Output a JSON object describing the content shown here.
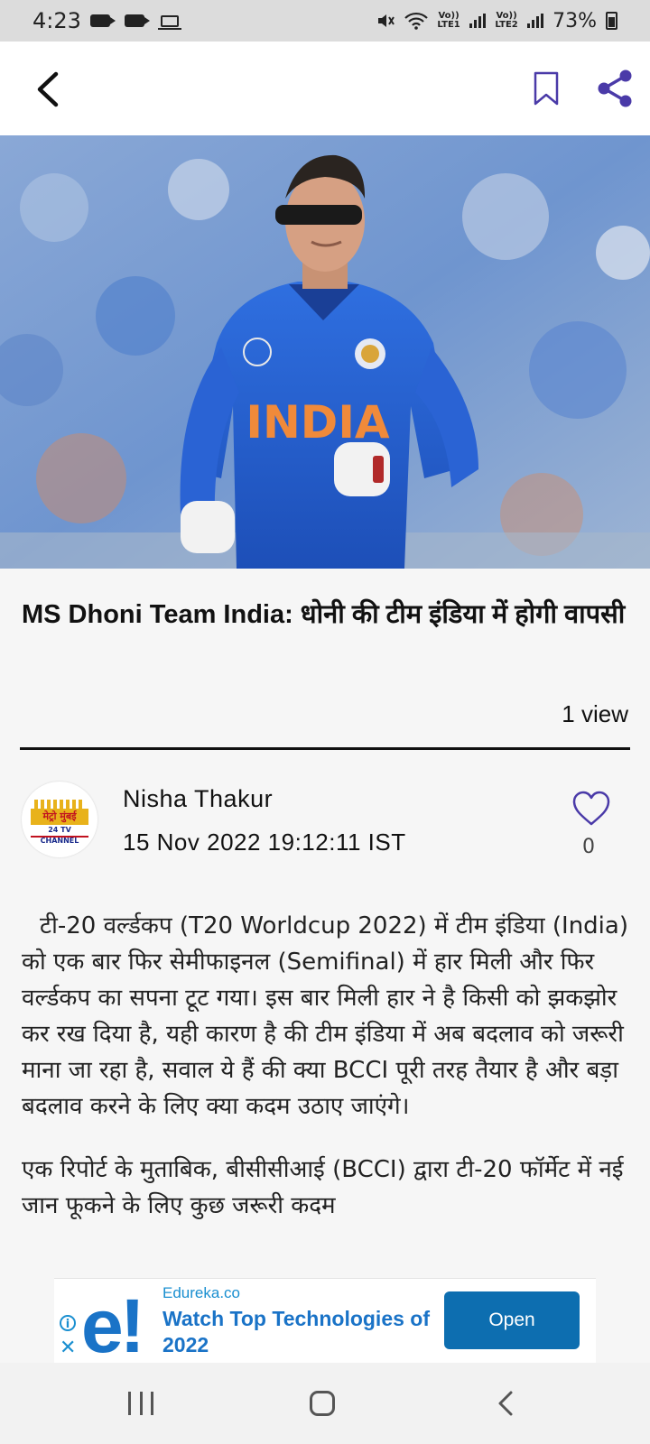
{
  "status_bar": {
    "time": "4:23",
    "sim1_label": "Vo)) LTE1",
    "sim2_label": "Vo)) LTE2",
    "battery": "73%"
  },
  "app_bar": {
    "back_icon": "chevron-left-icon",
    "bookmark_icon": "bookmark-icon",
    "share_icon": "share-icon"
  },
  "article": {
    "hero_image": "Cricketer in blue India jersey and sunglasses running on field",
    "jersey_text": "INDIA",
    "title": "MS Dhoni Team India: धोनी की टीम इंडिया में होगी वापसी",
    "views": "1 view",
    "author": "Nisha Thakur",
    "date": "15 Nov 2022 19:12:11 IST",
    "likes": "0",
    "channel_logo_top": "मेट्रो मुंबई",
    "channel_logo_bottom": "24 TV CHANNEL",
    "paragraphs": [
      "टी-20 वर्ल्डकप (T20 Worldcup 2022) में टीम इंडिया (India) को एक बार फिर सेमीफाइनल (Semifinal) में हार मिली और फिर वर्ल्डकप का सपना टूट गया। इस बार मिली हार ने है किसी को झकझोर कर रख दिया है, यही कारण है की टीम इंडिया में अब बदलाव को जरूरी माना जा रहा है, सवाल ये हैं की क्या BCCI पूरी तरह तैयार है और बड़ा बदलाव करने के लिए क्या कदम उठाए जाएंगे।",
      "एक रिपोर्ट के मुताबिक, बीसीसीआई (BCCI) द्वारा टी-20 फॉर्मेट में नई जान फूकने के लिए कुछ जरूरी कदम"
    ]
  },
  "ad": {
    "domain": "Edureka.co",
    "headline": "Watch Top Technologies of 2022",
    "cta": "Open",
    "logo_text": "e!"
  },
  "colors": {
    "accent": "#4a3aa8",
    "ad_blue": "#1a73c7",
    "ad_button": "#0d6eb0"
  }
}
